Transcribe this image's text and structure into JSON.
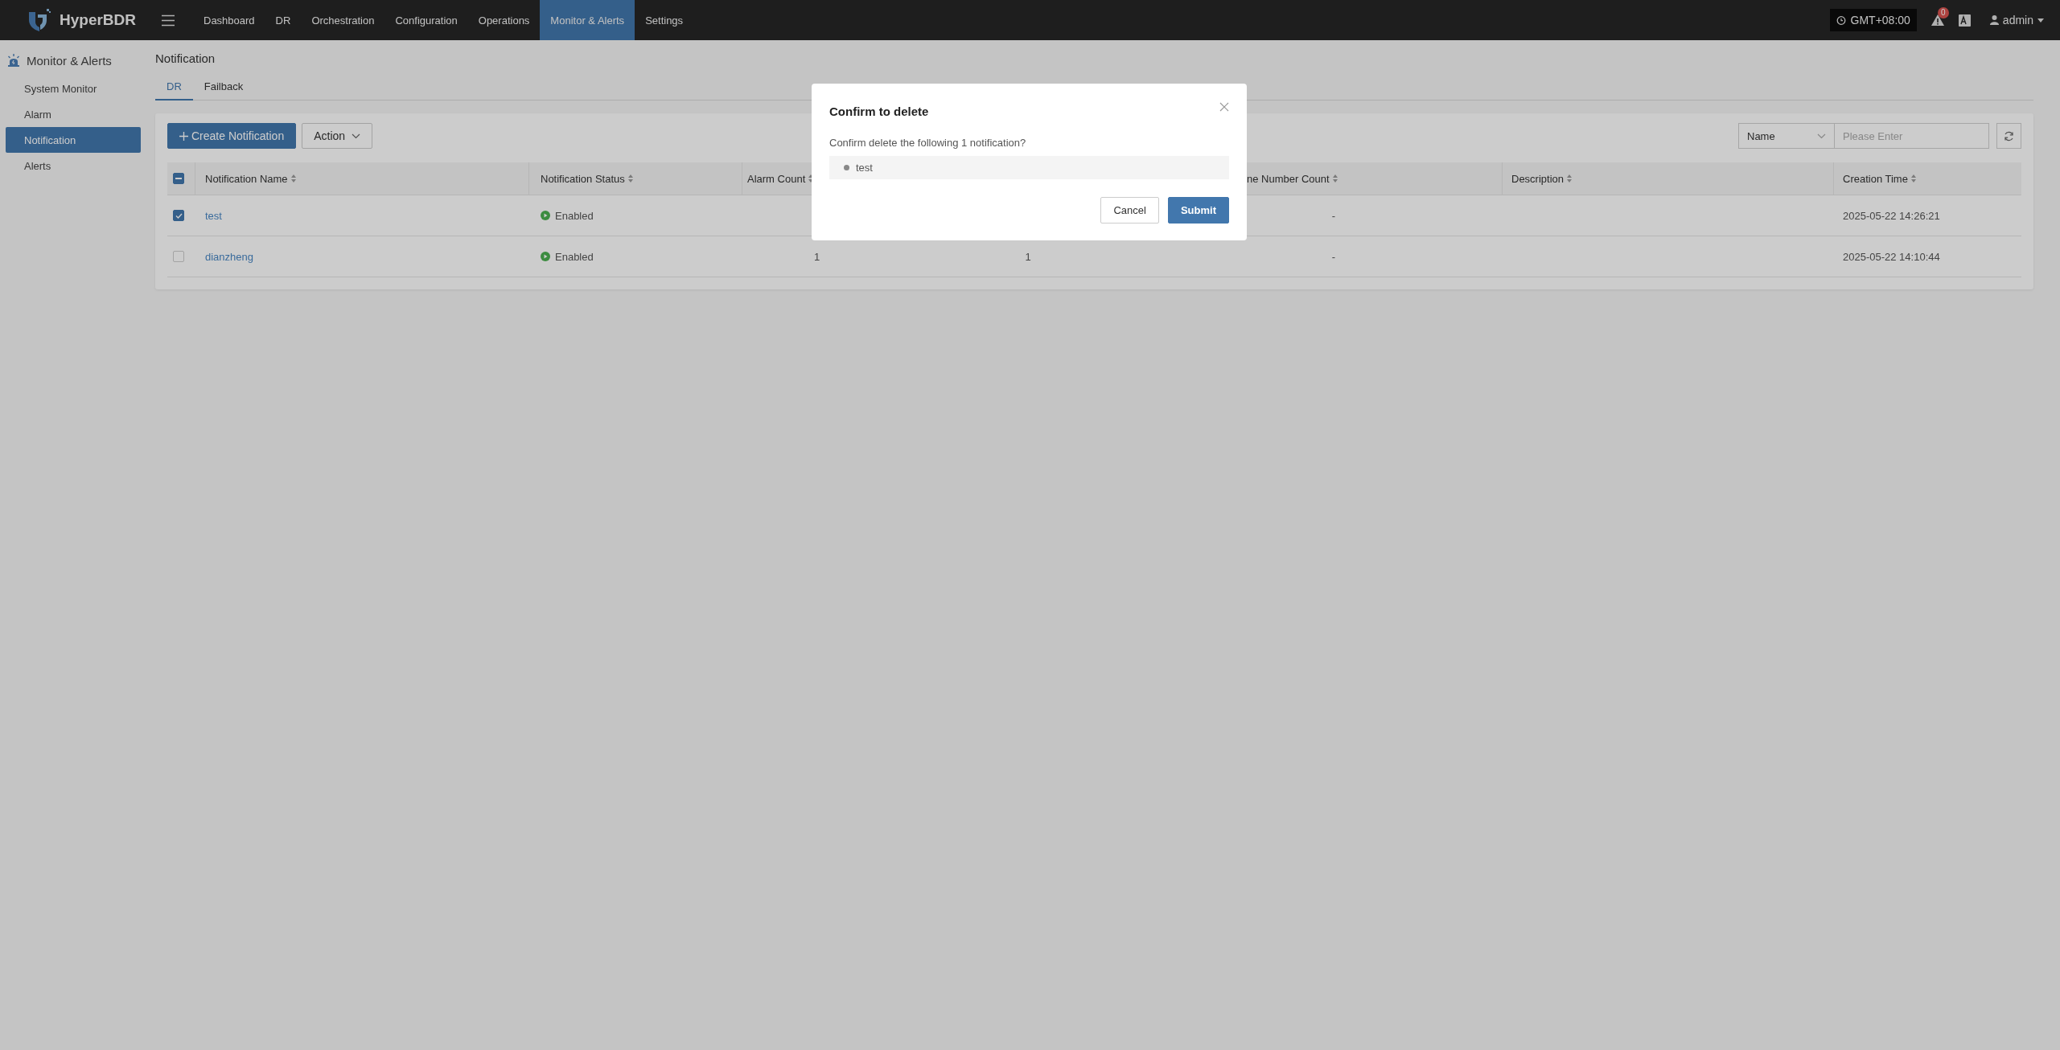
{
  "topbar": {
    "brand": "HyperBDR",
    "nav": [
      {
        "label": "Dashboard",
        "selected": false
      },
      {
        "label": "DR",
        "selected": false
      },
      {
        "label": "Orchestration",
        "selected": false
      },
      {
        "label": "Configuration",
        "selected": false
      },
      {
        "label": "Operations",
        "selected": false
      },
      {
        "label": "Monitor & Alerts",
        "selected": true
      },
      {
        "label": "Settings",
        "selected": false
      }
    ],
    "timezone": "GMT+08:00",
    "alert_count": "0",
    "user": "admin"
  },
  "sidebar": {
    "title": "Monitor & Alerts",
    "items": [
      {
        "label": "System Monitor",
        "selected": false
      },
      {
        "label": "Alarm",
        "selected": false
      },
      {
        "label": "Notification",
        "selected": true
      },
      {
        "label": "Alerts",
        "selected": false
      }
    ]
  },
  "page": {
    "title": "Notification",
    "tabs": [
      {
        "label": "DR",
        "selected": true
      },
      {
        "label": "Failback",
        "selected": false
      }
    ]
  },
  "toolbar": {
    "create_button": "Create Notification",
    "action_button": "Action",
    "search_field": "Name",
    "search": {
      "placeholder": "Please Enter"
    }
  },
  "table": {
    "select_all_indeterminate": true,
    "columns": {
      "name": "Notification Name",
      "status": "Notification Status",
      "alarm_count": "Alarm Count",
      "column_5": "ne Number Count",
      "description": "Description",
      "creation_time": "Creation Time"
    },
    "rows": [
      {
        "selected": true,
        "name": "test",
        "status": "Enabled",
        "column_5": "-",
        "creation_time": "2025-05-22 14:26:21"
      },
      {
        "selected": false,
        "name": "dianzheng",
        "status": "Enabled",
        "alarm_count": "1",
        "column_4": "1",
        "column_5": "-",
        "creation_time": "2025-05-22 14:10:44"
      }
    ]
  },
  "dialog": {
    "title": "Confirm to delete",
    "message": "Confirm delete the following 1 notification?",
    "items": [
      "test"
    ],
    "buttons": {
      "cancel": "Cancel",
      "submit": "Submit"
    }
  }
}
